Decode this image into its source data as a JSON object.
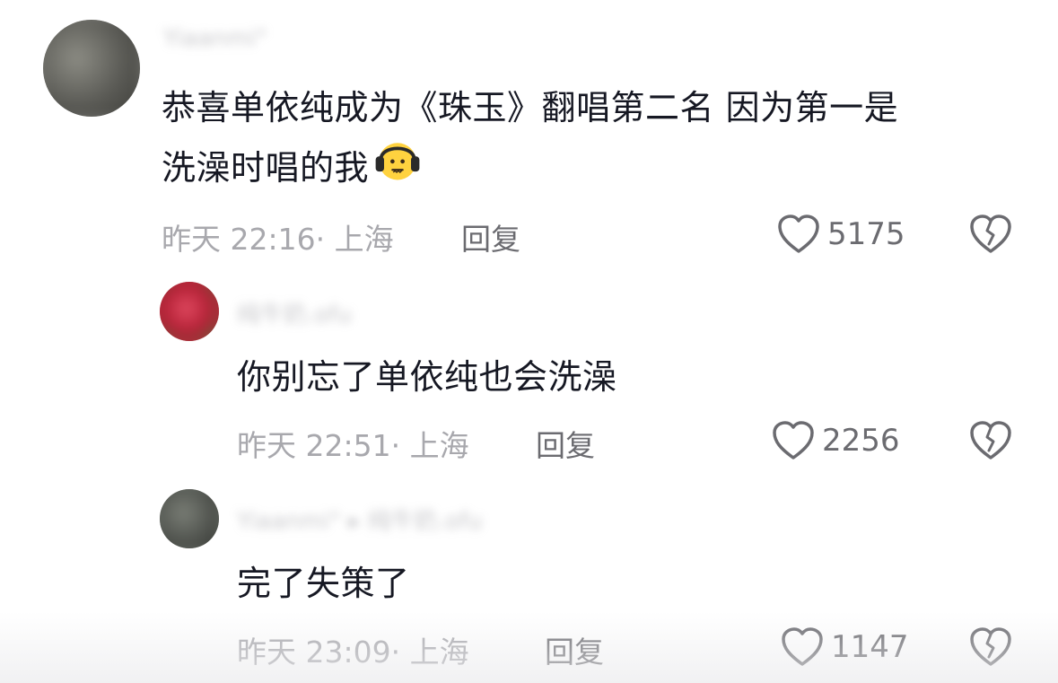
{
  "comments": [
    {
      "username": "Yiaanmi°",
      "text_line1": "恭喜单依纯成为《珠玉》翻唱第二名 因为第一是",
      "text_line2": "洗澡时唱的我",
      "emoji": "headphones-face-emoji",
      "meta": "昨天 22:16· 上海",
      "reply_label": "回复",
      "likes": "5175"
    },
    {
      "username": "纯牛奶.ofu",
      "text": "你别忘了单依纯也会洗澡",
      "meta": "昨天 22:51· 上海",
      "reply_label": "回复",
      "likes": "2256"
    },
    {
      "username": "Yiaanmi° ▸ 纯牛奶.ofu",
      "text": "完了失策了",
      "meta": "昨天 23:09· 上海",
      "reply_label": "回复",
      "likes": "1147"
    }
  ],
  "icons": {
    "like": "heart-outline-icon",
    "dislike": "broken-heart-icon"
  },
  "colors": {
    "text": "#161823",
    "meta": "#a8a8ad",
    "action": "#6b6b70"
  }
}
